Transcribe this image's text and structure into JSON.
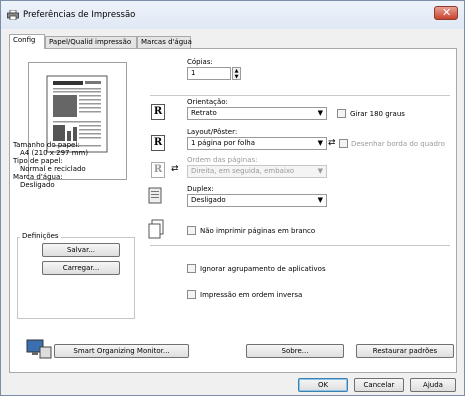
{
  "window": {
    "title": "Preferências de Impressão",
    "close_label": "✕"
  },
  "tabs": [
    "Config",
    "Papel/Qualid impressão",
    "Marcas d'água"
  ],
  "summary": {
    "paper_size_label": "Tamanho do papel:",
    "paper_size_value": "A4 (210 x 297 mm)",
    "paper_type_label": "Tipo de papel:",
    "paper_type_value": "Normal e reciclado",
    "watermark_label": "Marca d'água:",
    "watermark_value": "Desligado"
  },
  "definitions": {
    "group_label": "Definições",
    "save_label": "Salvar...",
    "load_label": "Carregar..."
  },
  "copies": {
    "label": "Cópias:",
    "value": "1"
  },
  "orientation": {
    "label": "Orientação:",
    "value": "Retrato",
    "rotate_label": "Girar 180 graus"
  },
  "layout": {
    "label": "Layout/Pôster:",
    "value": "1 página por folha",
    "border_label": "Desenhar borda do quadro"
  },
  "page_order": {
    "label": "Ordem das páginas:",
    "value": "Direita, em seguida, embaixo"
  },
  "duplex": {
    "label": "Duplex:",
    "value": "Desligado"
  },
  "options": {
    "blank_pages": "Não imprimir páginas em branco",
    "ignore_collate": "Ignorar agrupamento de aplicativos",
    "reverse_order": "Impressão em ordem inversa"
  },
  "footer": {
    "smart_monitor": "Smart Organizing Monitor...",
    "about": "Sobre...",
    "restore": "Restaurar padrões",
    "ok": "OK",
    "cancel": "Cancelar",
    "help": "Ajuda"
  },
  "icons": {
    "r_glyph": "R",
    "info_glyph": "⇄",
    "spin_up": "▲",
    "spin_down": "▼",
    "dropdown": "▼"
  }
}
